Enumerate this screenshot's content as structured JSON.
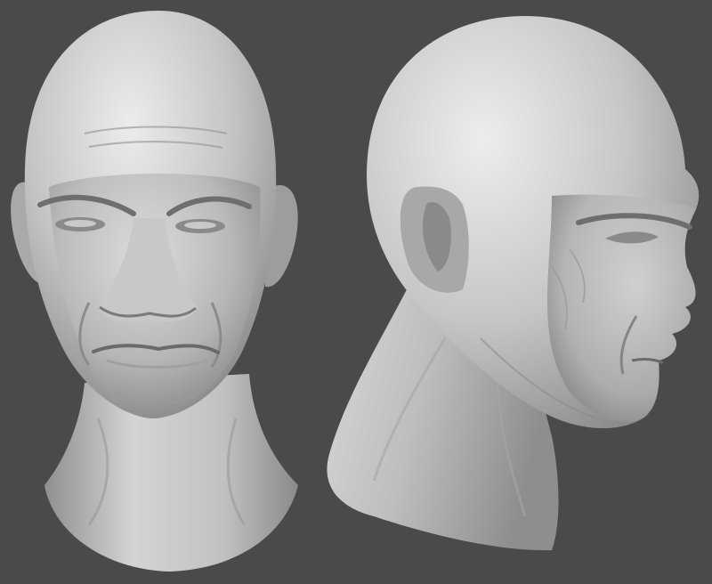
{
  "scene": {
    "background_color": "#4a4a4a",
    "clay_light": "#e6e6e6",
    "clay_mid": "#b5b5b5",
    "clay_dark": "#6e6e6e",
    "subjects": [
      {
        "view": "front",
        "description_name": "front-view-head-sculpt"
      },
      {
        "view": "profile-right",
        "description_name": "profile-view-head-sculpt"
      }
    ]
  }
}
